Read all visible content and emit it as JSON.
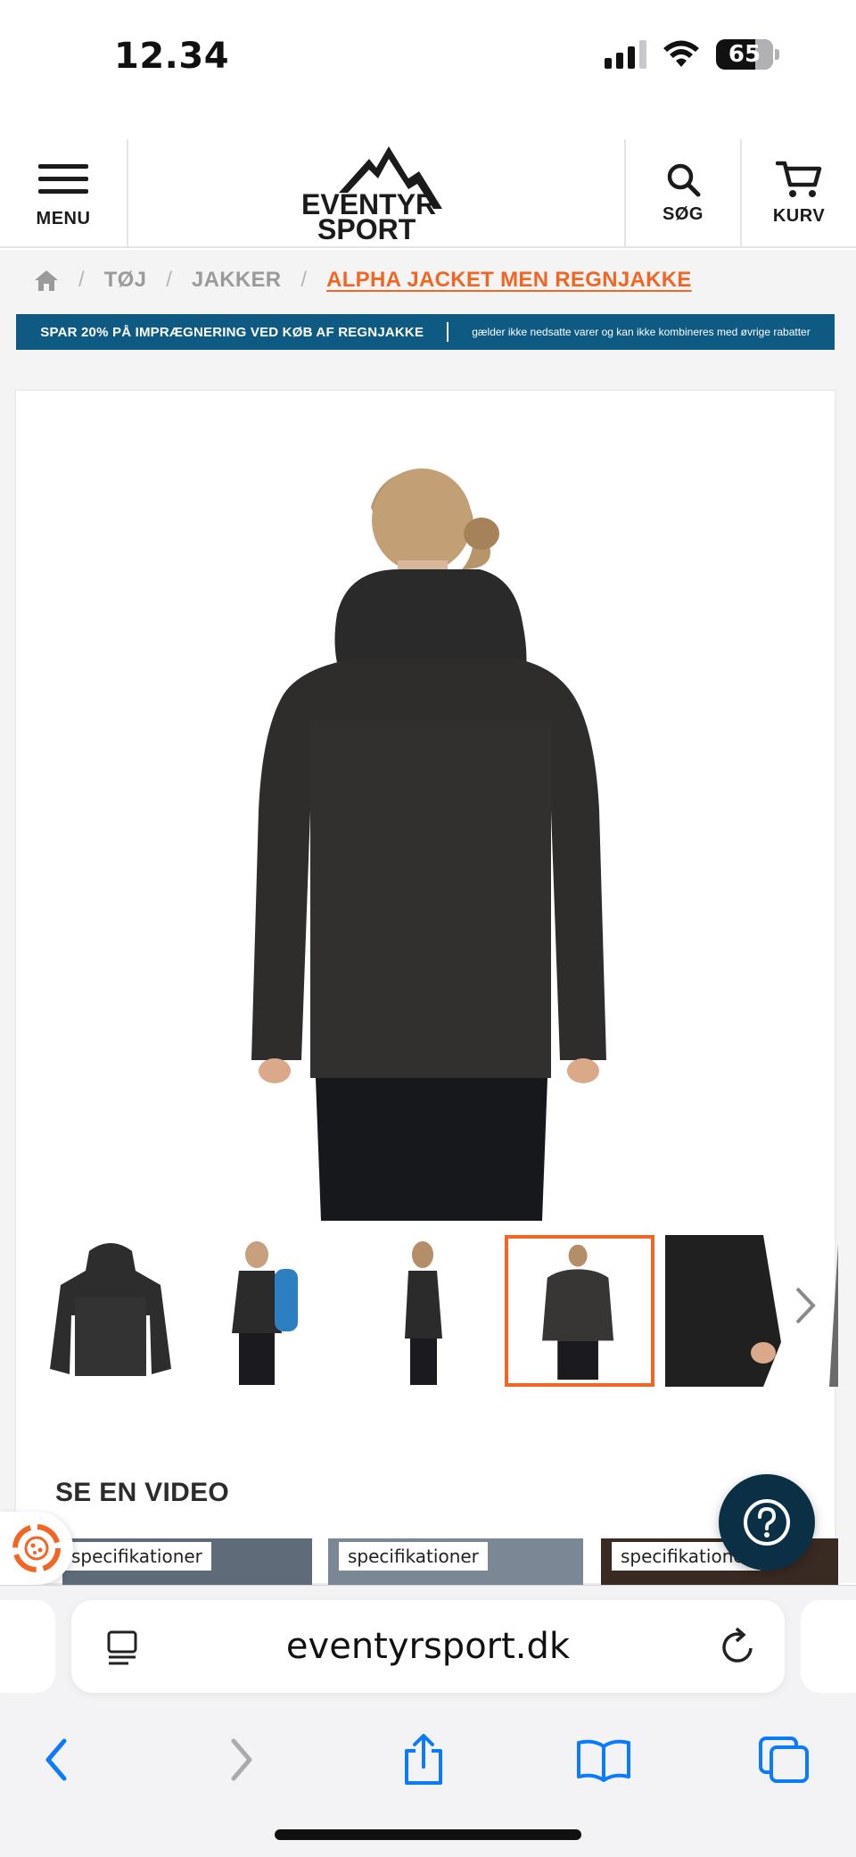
{
  "status_bar": {
    "time": "12.34",
    "battery": "65"
  },
  "header": {
    "menu_label": "MENU",
    "logo_line1": "EVENTYR",
    "logo_line2": "SPORT",
    "search_label": "SØG",
    "cart_label": "KURV"
  },
  "breadcrumb": {
    "items": [
      "TØJ",
      "JAKKER"
    ],
    "separator": "/",
    "current": "ALPHA JACKET MEN REGNJAKKE"
  },
  "promo": {
    "main": "SPAR 20% PÅ IMPRÆGNERING VED KØB AF REGNJAKKE",
    "sub": "gælder ikke nedsatte varer og kan ikke kombineres med øvrige rabatter"
  },
  "product": {
    "selected_thumbnail_index": 3
  },
  "video_section": {
    "title": "SE EN VIDEO",
    "videos": [
      {
        "chip": "specifikationer"
      },
      {
        "chip": "specifikationer"
      },
      {
        "chip": "specifikationer"
      }
    ]
  },
  "browser": {
    "url": "eventyrsport.dk"
  },
  "colors": {
    "accent": "#f26522",
    "promo_bg": "#0e5a82",
    "help_bg": "#0b2f44",
    "ios_blue": "#0a7aff"
  },
  "icons": [
    "home-icon",
    "search-icon",
    "cart-icon",
    "menu-icon",
    "question-icon",
    "cookie-icon",
    "reader-icon",
    "reload-icon",
    "back-icon",
    "forward-icon",
    "share-icon",
    "bookmarks-icon",
    "tabs-icon"
  ]
}
